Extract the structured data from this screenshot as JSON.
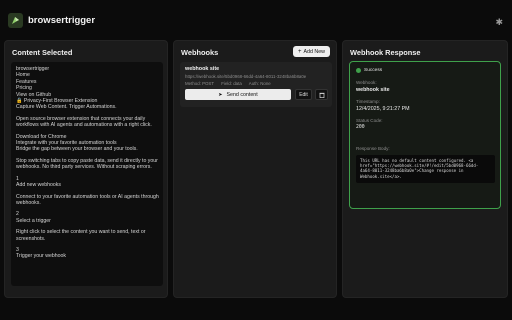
{
  "app": {
    "title": "browsertrigger"
  },
  "content_panel": {
    "title": "Content Selected",
    "lines": [
      "browsertrigger",
      "Home",
      "Features",
      "Pricing",
      "View on Github",
      "🔒 Privacy-First Browser Extension",
      "Capture Web Content. Trigger Automations.",
      "",
      "Open source browser extension that connects your daily",
      "workflows with AI agents and automations with a right click.",
      "",
      "Download for Chrome",
      "Integrate with your favorite automation tools",
      "Bridge the gap between your browser and your tools.",
      "",
      "Stop switching tabs to copy paste data, send it directly to your",
      "webhooks. No third party services. Without scraping errors.",
      "",
      "1",
      "Add new webhooks",
      "",
      "Connect to your favorite automation tools or AI agents through",
      "webhooks.",
      "",
      "2",
      "Select a trigger",
      "",
      "Right click to select the content you want to send, text or",
      "screenshots.",
      "",
      "3",
      "Trigger your webhook"
    ]
  },
  "webhooks_panel": {
    "title": "Webhooks",
    "new_button": "Add New",
    "webhook": {
      "name": "webhook site",
      "url": "https://webhook.site/5bd0968-66dd-4a64-8011-3248ba6b8a0e",
      "method": "Method: POST",
      "field": "Field: data",
      "auth": "Auth: None",
      "send_label": "Send content",
      "edit_label": "Edit"
    }
  },
  "response_panel": {
    "title": "Webhook Response",
    "status": "Success",
    "webhook_label": "Webhook:",
    "webhook_value": "webhook site",
    "timestamp_label": "Timestamp:",
    "timestamp_value": "12/4/2025, 9:21:27 PM",
    "status_code_label": "Status Code:",
    "status_code_value": "200",
    "body_label": "Response Body:",
    "body_lines": [
      "This URL has no default content configured. <a",
      "href=\"https://webhook.site/#!/edit/5bd0968-66dd-",
      "4a64-8011-3248ba6b8a0e\">Change response in",
      "Webhook.site</a>."
    ]
  },
  "colors": {
    "accent_green": "#3fa14b",
    "background": "#0b0b0b",
    "panel": "#1b1b1b"
  },
  "icons": [
    "logo-icon",
    "settings-icon",
    "plus-icon",
    "send-icon",
    "trash-icon",
    "check-icon"
  ]
}
